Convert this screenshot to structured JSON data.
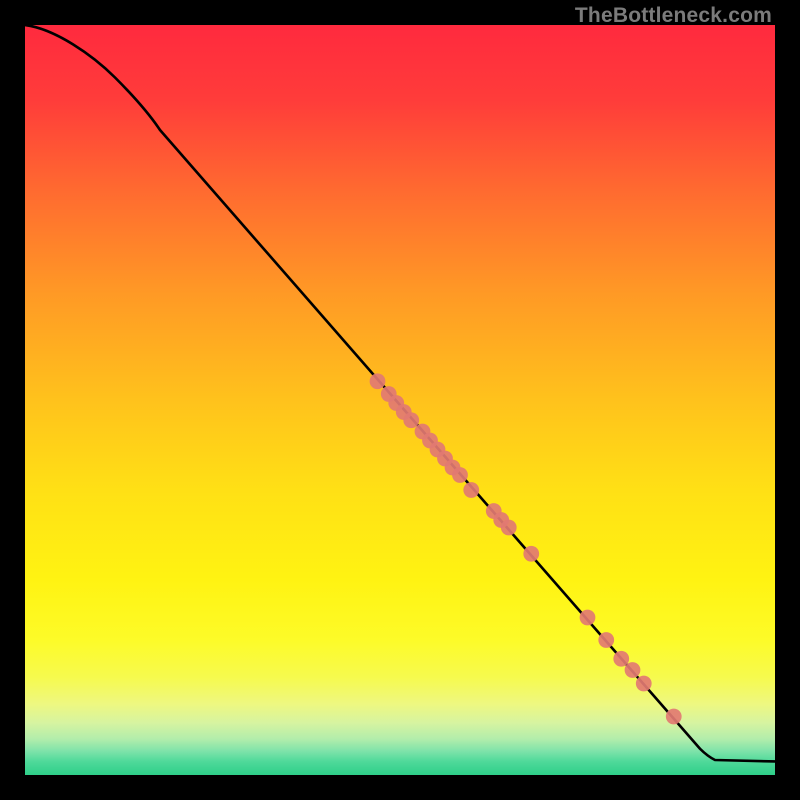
{
  "watermark": "TheBottleneck.com",
  "chart_data": {
    "type": "line",
    "title": "",
    "xlabel": "",
    "ylabel": "",
    "xlim": [
      0,
      100
    ],
    "ylim": [
      0,
      100
    ],
    "curve": [
      {
        "x": 0,
        "y": 100
      },
      {
        "x": 6,
        "y": 98
      },
      {
        "x": 12,
        "y": 93
      },
      {
        "x": 18,
        "y": 86
      },
      {
        "x": 90,
        "y": 3.5
      },
      {
        "x": 92,
        "y": 2.0
      },
      {
        "x": 100,
        "y": 1.8
      }
    ],
    "points": [
      {
        "x": 47.0,
        "y": 52.5
      },
      {
        "x": 48.5,
        "y": 50.8
      },
      {
        "x": 49.5,
        "y": 49.6
      },
      {
        "x": 50.5,
        "y": 48.4
      },
      {
        "x": 51.5,
        "y": 47.3
      },
      {
        "x": 53.0,
        "y": 45.8
      },
      {
        "x": 54.0,
        "y": 44.6
      },
      {
        "x": 55.0,
        "y": 43.4
      },
      {
        "x": 56.0,
        "y": 42.2
      },
      {
        "x": 57.0,
        "y": 41.0
      },
      {
        "x": 58.0,
        "y": 40.0
      },
      {
        "x": 59.5,
        "y": 38.0
      },
      {
        "x": 62.5,
        "y": 35.2
      },
      {
        "x": 63.5,
        "y": 34.0
      },
      {
        "x": 64.5,
        "y": 33.0
      },
      {
        "x": 67.5,
        "y": 29.5
      },
      {
        "x": 75.0,
        "y": 21.0
      },
      {
        "x": 77.5,
        "y": 18.0
      },
      {
        "x": 79.5,
        "y": 15.5
      },
      {
        "x": 81.0,
        "y": 14.0
      },
      {
        "x": 82.5,
        "y": 12.2
      },
      {
        "x": 86.5,
        "y": 7.8
      }
    ],
    "gradient_stops": [
      {
        "pos": 0.0,
        "color": "#ff2a3e"
      },
      {
        "pos": 0.1,
        "color": "#ff3c3a"
      },
      {
        "pos": 0.22,
        "color": "#ff6a30"
      },
      {
        "pos": 0.36,
        "color": "#ff9a25"
      },
      {
        "pos": 0.5,
        "color": "#ffc21c"
      },
      {
        "pos": 0.62,
        "color": "#ffe015"
      },
      {
        "pos": 0.74,
        "color": "#fff312"
      },
      {
        "pos": 0.82,
        "color": "#fdfb28"
      },
      {
        "pos": 0.87,
        "color": "#f6fa4e"
      },
      {
        "pos": 0.905,
        "color": "#eef880"
      },
      {
        "pos": 0.93,
        "color": "#d7f4a0"
      },
      {
        "pos": 0.952,
        "color": "#b2edab"
      },
      {
        "pos": 0.968,
        "color": "#7fe3aa"
      },
      {
        "pos": 0.982,
        "color": "#4fd99a"
      },
      {
        "pos": 1.0,
        "color": "#2ecf89"
      }
    ],
    "point_color": "#e27a72",
    "line_color": "#000000"
  }
}
